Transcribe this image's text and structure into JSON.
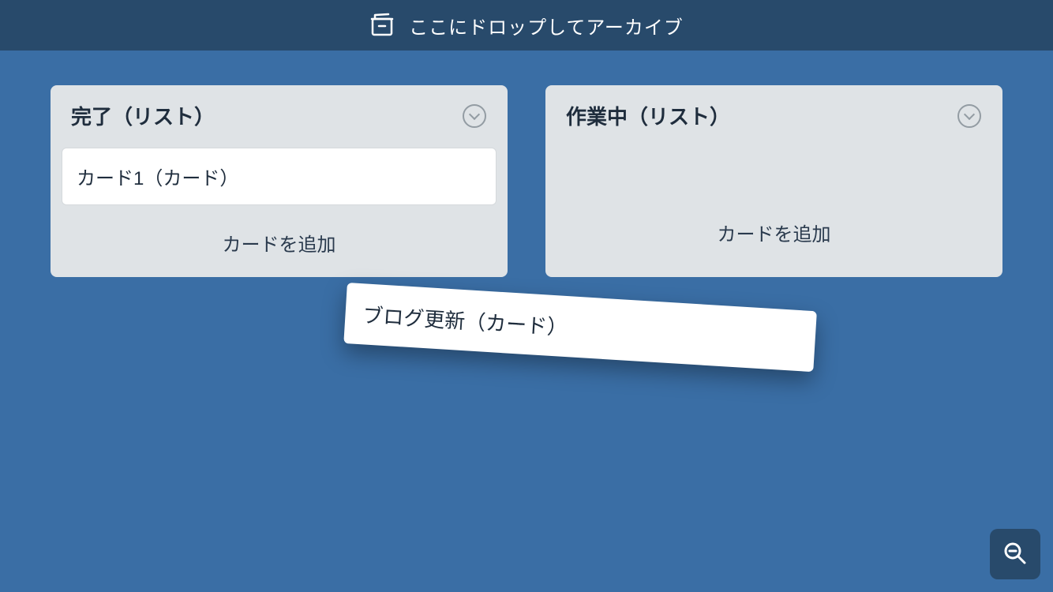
{
  "archive_banner": {
    "label": "ここにドロップしてアーカイブ"
  },
  "lists": [
    {
      "title": "完了（リスト）",
      "add_card_label": "カードを追加",
      "cards": [
        {
          "title": "カード1（カード）"
        }
      ]
    },
    {
      "title": "作業中（リスト）",
      "add_card_label": "カードを追加",
      "cards": []
    }
  ],
  "dragging_card": {
    "title": "ブログ更新（カード）"
  }
}
